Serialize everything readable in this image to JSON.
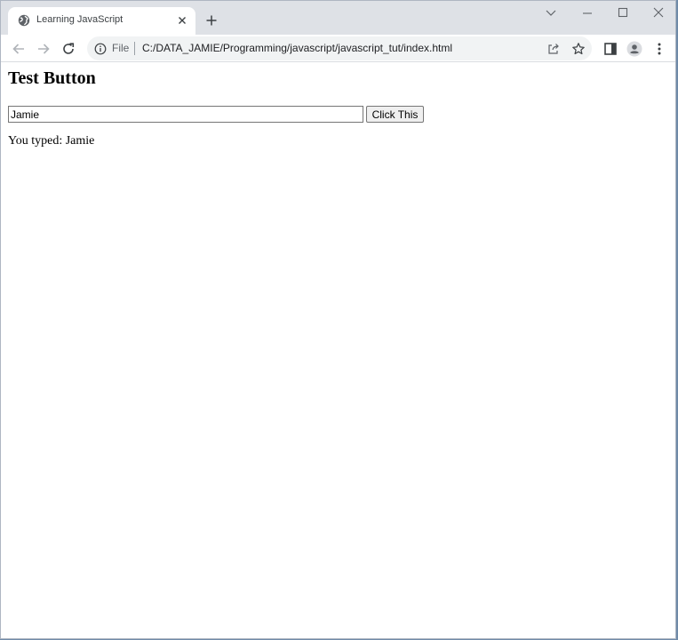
{
  "browser": {
    "tab": {
      "title": "Learning JavaScript",
      "favicon": "globe-icon"
    },
    "address_bar": {
      "scheme_label": "File",
      "url": "C:/DATA_JAMIE/Programming/javascript/javascript_tut/index.html"
    },
    "icons": {
      "back": "back-arrow-icon",
      "forward": "forward-arrow-icon",
      "reload": "reload-icon",
      "info": "info-icon",
      "share": "share-icon",
      "bookmark": "star-icon",
      "side_panel": "side-panel-icon",
      "profile": "profile-icon",
      "menu": "kebab-menu-icon"
    },
    "colors": {
      "tabstrip": "#dee1e6",
      "omnibox": "#f1f3f4",
      "icon": "#5f6368"
    }
  },
  "page": {
    "heading": "Test Button",
    "input_value": "Jamie",
    "button_label": "Click This",
    "typed_prefix": "You typed: ",
    "typed_value": "Jamie"
  }
}
